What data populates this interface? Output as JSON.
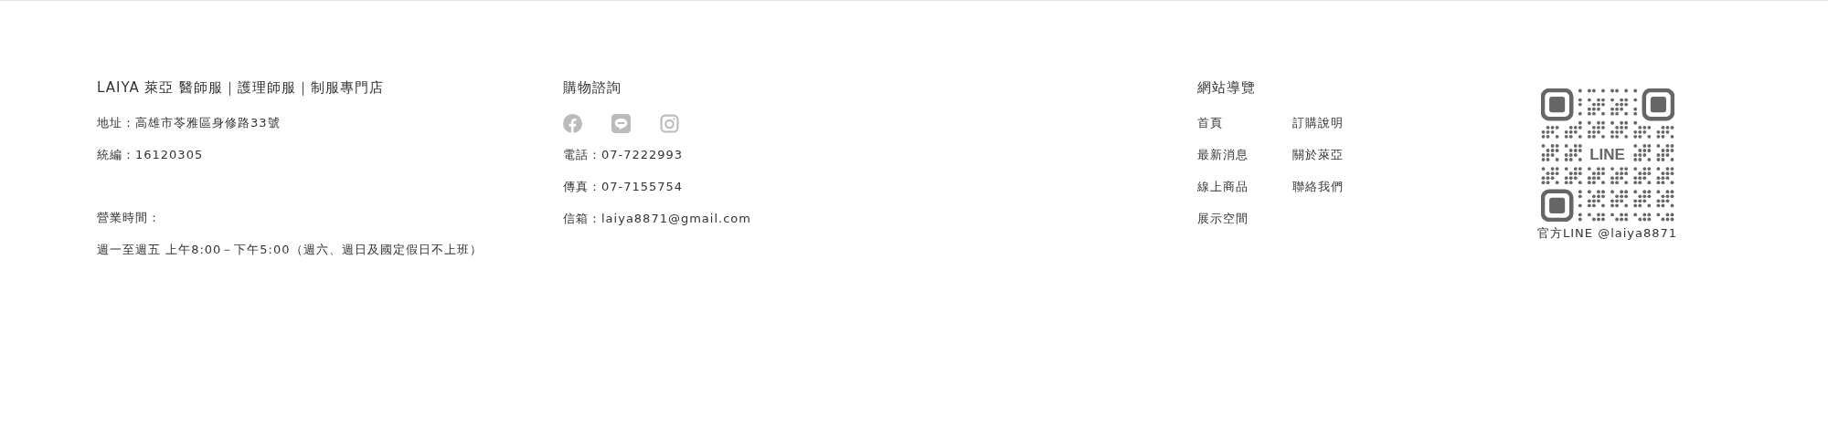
{
  "company": {
    "title": "LAIYA 萊亞 醫師服｜護理師服｜制服專門店",
    "address": "地址：高雄市苓雅區身修路33號",
    "tax_id": "統編：16120305",
    "hours_label": "營業時間：",
    "hours": "週一至週五 上午8:00－下午5:00（週六、週日及國定假日不上班）"
  },
  "contact": {
    "title": "購物諮詢",
    "social": [
      {
        "kind": "facebook"
      },
      {
        "kind": "line"
      },
      {
        "kind": "instagram"
      }
    ],
    "lines": [
      "電話：07-7222993",
      "傳真：07-7155754",
      "信箱：laiya8871@gmail.com"
    ]
  },
  "nav": {
    "title": "網站導覽",
    "columns": [
      [
        "首頁",
        "最新消息",
        "線上商品",
        "展示空間"
      ],
      [
        "訂購說明",
        "關於萊亞",
        "聯絡我們"
      ]
    ]
  },
  "qr": {
    "center_label": "LINE",
    "caption": "官方LINE @laiya8871"
  }
}
